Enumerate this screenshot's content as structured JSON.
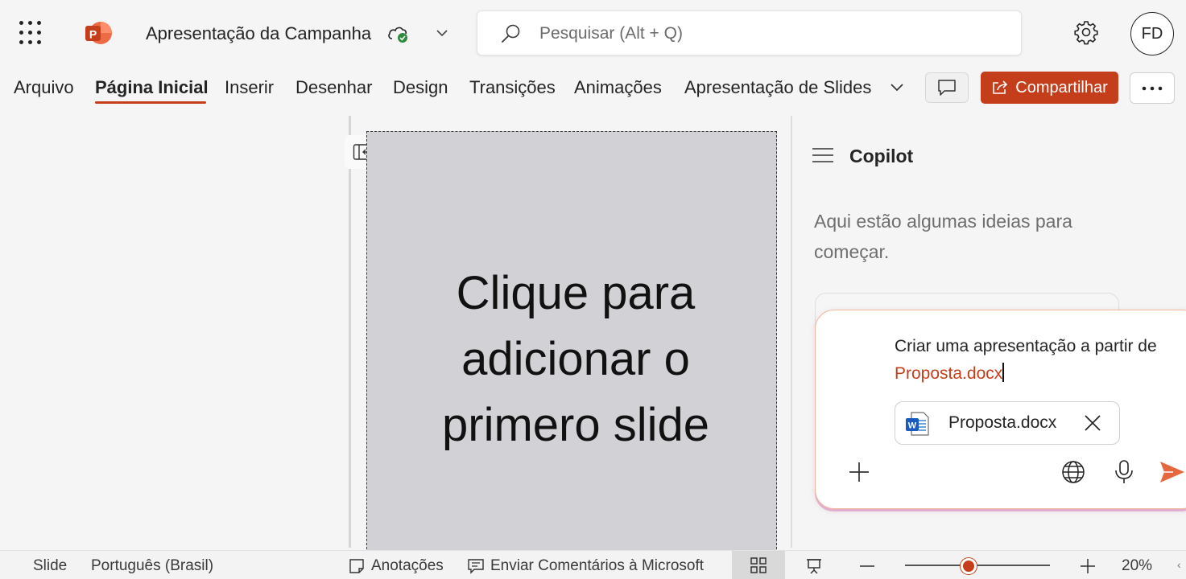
{
  "app": {
    "document_title": "Apresentação da Campanha",
    "search_placeholder": "Pesquisar (Alt + Q)",
    "avatar_initials": "FD",
    "accent_color": "#c43e1c"
  },
  "ribbon": {
    "tabs": [
      "Arquivo",
      "Página Inicial",
      "Inserir",
      "Desenhar",
      "Design",
      "Transições",
      "Animações",
      "Apresentação de Slides"
    ],
    "active_tab": "Página Inicial",
    "share_label": "Compartilhar"
  },
  "slide": {
    "placeholder_text": "Clique para adicionar o primero slide",
    "lines": [
      "Clique para",
      "adicionar o",
      "primero slide"
    ]
  },
  "copilot": {
    "title": "Copilot",
    "intro": "Aqui estão algumas ideias para começar.",
    "prompt_text": "Criar uma apresentação a partir de ",
    "prompt_file": "Proposta.docx",
    "attached_file": "Proposta.docx"
  },
  "status_bar": {
    "slide_label": "Slide",
    "language": "Português (Brasil)",
    "notes_label": "Anotações",
    "feedback_label": "Enviar Comentários à Microsoft",
    "zoom_level": "20%",
    "zoom_fraction": 0.44
  },
  "icons": {
    "app_launcher": "waffle-icon",
    "app": "powerpoint-logo",
    "sync": "cloud-check-icon",
    "search": "search-icon",
    "settings": "gear-icon",
    "comments": "comment-icon",
    "share": "share-icon",
    "more": "more-icon",
    "collapse": "collapse-pane-icon",
    "menu": "hamburger-icon",
    "word": "word-file-icon",
    "close": "close-icon",
    "add": "plus-icon",
    "web": "globe-icon",
    "mic": "microphone-icon",
    "send": "send-icon"
  }
}
